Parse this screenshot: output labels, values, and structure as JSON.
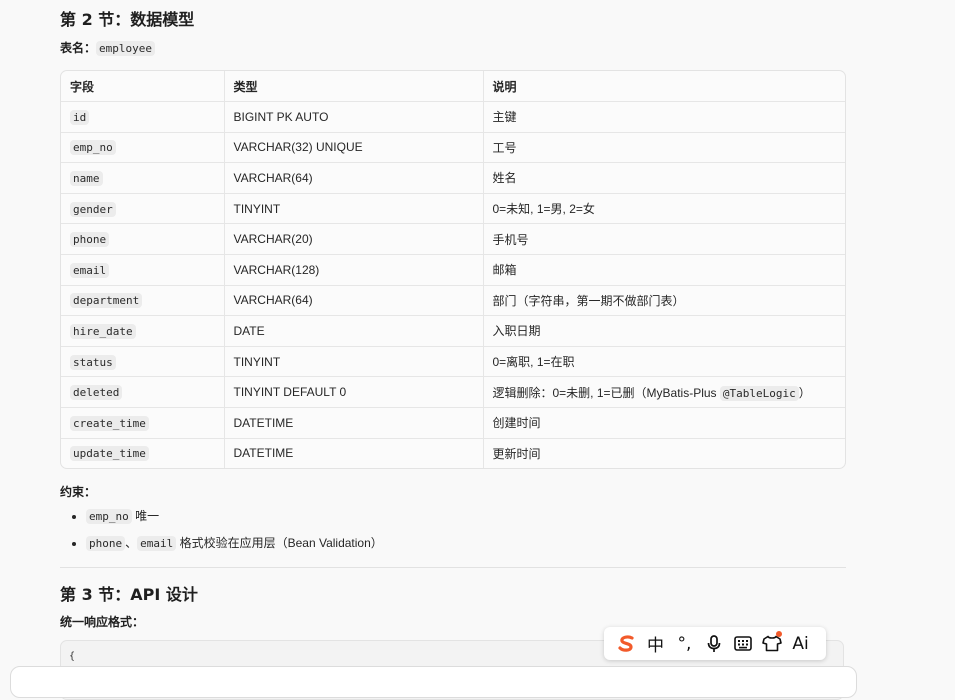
{
  "section2": {
    "title": "第 2 节：数据模型",
    "table_label_prefix": "表名：",
    "table_name": "employee",
    "columns": [
      "字段",
      "类型",
      "说明"
    ],
    "rows": [
      {
        "field": "id",
        "type": "BIGINT PK AUTO",
        "desc": "主键"
      },
      {
        "field": "emp_no",
        "type": "VARCHAR(32) UNIQUE",
        "desc": "工号"
      },
      {
        "field": "name",
        "type": "VARCHAR(64)",
        "desc": "姓名"
      },
      {
        "field": "gender",
        "type": "TINYINT",
        "desc": "0=未知, 1=男, 2=女"
      },
      {
        "field": "phone",
        "type": "VARCHAR(20)",
        "desc": "手机号"
      },
      {
        "field": "email",
        "type": "VARCHAR(128)",
        "desc": "邮箱"
      },
      {
        "field": "department",
        "type": "VARCHAR(64)",
        "desc": "部门（字符串，第一期不做部门表）"
      },
      {
        "field": "hire_date",
        "type": "DATE",
        "desc": "入职日期"
      },
      {
        "field": "status",
        "type": "TINYINT",
        "desc": "0=离职, 1=在职"
      },
      {
        "field": "deleted",
        "type": "TINYINT DEFAULT 0",
        "desc": "逻辑删除：0=未删, 1=已删（MyBatis-Plus ",
        "desc_code": "@TableLogic",
        "desc_suffix": "）"
      },
      {
        "field": "create_time",
        "type": "DATETIME",
        "desc": "创建时间"
      },
      {
        "field": "update_time",
        "type": "DATETIME",
        "desc": "更新时间"
      }
    ],
    "constraints_label": "约束：",
    "constraints": [
      {
        "code1": "emp_no",
        "text": " 唯一"
      },
      {
        "code1": "phone",
        "sep": "、",
        "code2": "email",
        "text": " 格式校验在应用层（Bean Validation）"
      }
    ]
  },
  "section3": {
    "title": "第 3 节：API 设计",
    "response_label": "统一响应格式：",
    "code_first_line": "{"
  },
  "ime": {
    "logo": "S",
    "lang": "中",
    "punct": "°,",
    "ai": "Ai",
    "icons": [
      "sogou-logo-icon",
      "chinese-mode-icon",
      "punctuation-icon",
      "microphone-icon",
      "keyboard-icon",
      "skin-shirt-icon",
      "ai-icon"
    ],
    "brand_color": "#f25a2a"
  }
}
